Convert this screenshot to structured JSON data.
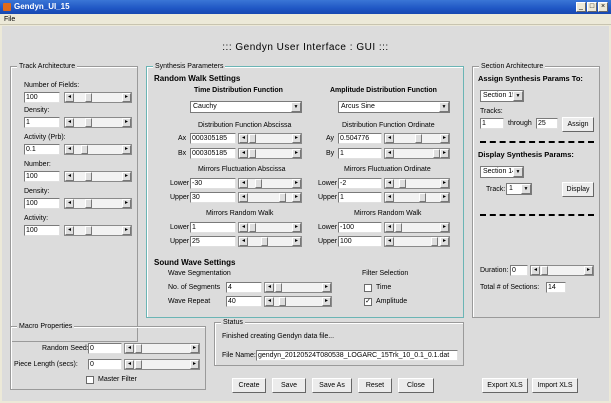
{
  "window": {
    "title": "Gendyn_UI_15"
  },
  "menu": {
    "file": "File"
  },
  "main_title": "::: Gendyn User Interface : GUI :::",
  "track": {
    "title": "Track Architecture",
    "fields": [
      {
        "label": "Number of Fields:",
        "value": "100"
      },
      {
        "label": "Density:",
        "value": "1"
      },
      {
        "label": "Activity (Prb):",
        "value": "0.1"
      },
      {
        "label": "Number:",
        "value": "100"
      },
      {
        "label": "Density:",
        "value": "100"
      },
      {
        "label": "Activity:",
        "value": "100"
      }
    ]
  },
  "synth": {
    "title": "Synthesis Parameters",
    "rw_title": "Random Walk Settings",
    "time": {
      "heading": "Time Distribution Function",
      "selected": "Cauchy",
      "abscissa_label": "Distribution Function Abscissa",
      "ax_label": "Ax",
      "ax_value": "000305185",
      "bx_label": "Bx",
      "bx_value": "000305185",
      "mfa_label": "Mirrors Fluctuation Abscissa",
      "lower_label": "Lower",
      "mfa_lower": "-30",
      "upper_label": "Upper",
      "mfa_upper": "30",
      "mrw_label": "Mirrors Random Walk",
      "mrw_lower": "1",
      "mrw_upper": "25"
    },
    "amp": {
      "heading": "Amplitude Distribution Function",
      "selected": "Arcus Sine",
      "ordinate_label": "Distribution Function Ordinate",
      "ay_label": "Ay",
      "ay_value": "0.504776",
      "by_label": "By",
      "by_value": "1",
      "mfo_label": "Mirrors Fluctuation Ordinate",
      "lower_label": "Lower",
      "mfo_lower": "-2",
      "upper_label": "Upper",
      "mfo_upper": "1",
      "mrw_label": "Mirrors Random Walk",
      "mrw_lower": "-100",
      "mrw_upper": "100"
    },
    "sw_title": "Sound Wave Settings",
    "wave_seg": "Wave Segmentation",
    "nseg_label": "No. of Segments",
    "nseg_value": "4",
    "repeat_label": "Wave Repeat",
    "repeat_value": "40",
    "filter_label": "Filter Selection",
    "time_label": "Time",
    "amplitude_label": "Amplitude"
  },
  "section": {
    "title": "Section Architecture",
    "assign_heading": "Assign Synthesis Params To:",
    "assign_section": "Section 15",
    "tracks_label": "Tracks:",
    "track_from": "1",
    "through_label": "through",
    "track_to": "25",
    "assign_button": "Assign",
    "display_heading": "Display Synthesis Params:",
    "display_section": "Section 14",
    "track_label": "Track:",
    "track_value": "1",
    "display_button": "Display",
    "duration_label": "Duration:",
    "duration_value": "0",
    "total_label": "Total # of Sections:",
    "total_value": "14"
  },
  "macro": {
    "title": "Macro Properties",
    "seed_label": "Random Seed:",
    "seed_value": "0",
    "piece_label": "Piece Length (secs):",
    "piece_value": "0",
    "master_label": "Master Filter"
  },
  "status": {
    "title": "Status",
    "message": "Finished creating Gendyn data file...",
    "file_label": "File Name:",
    "file_value": "gendyn_20120524T080538_LOGARC_15Trk_10_0.1_0.1.dat"
  },
  "buttons": {
    "create": "Create",
    "save": "Save",
    "save_as": "Save As",
    "reset": "Reset",
    "close": "Close",
    "export_xls": "Export XLS",
    "import_xls": "Import XLS"
  },
  "colors": {
    "titlebar": "#1f56c4",
    "panel_border_teal": "#6bb5b5",
    "background": "#dcdcdc"
  }
}
